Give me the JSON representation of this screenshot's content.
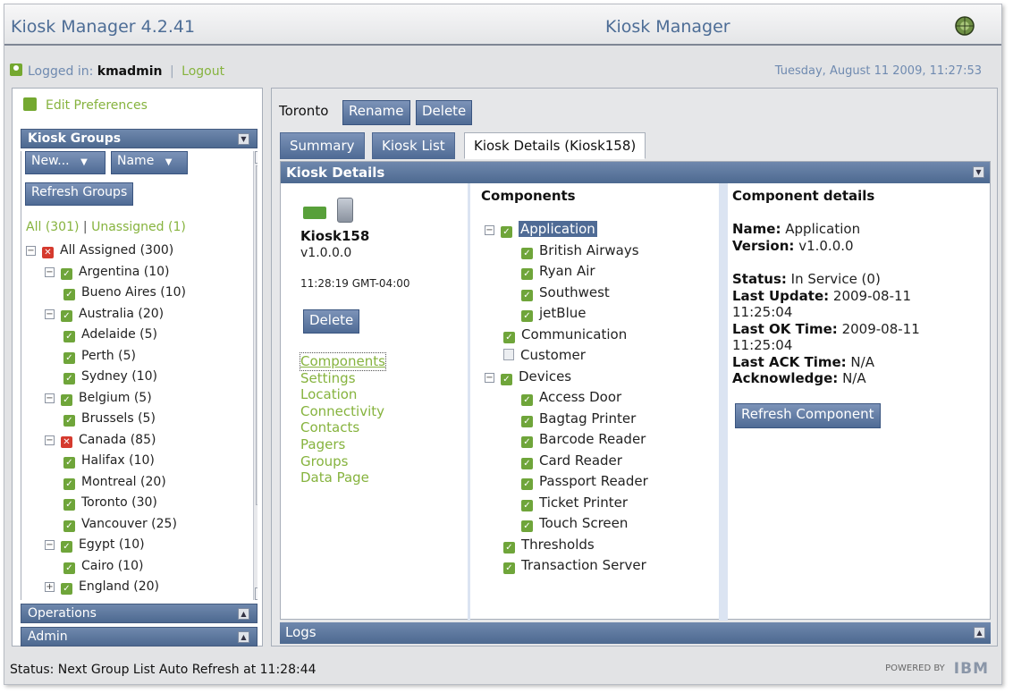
{
  "header": {
    "app_title": "Kiosk Manager 4.2.41",
    "center_title": "Kiosk Manager",
    "globe_icon": "globe-icon"
  },
  "login": {
    "label": "Logged in:",
    "user": "kmadmin",
    "separator": "|",
    "logout": "Logout",
    "datetime": "Tuesday, August 11 2009, 11:27:53"
  },
  "sidebar": {
    "edit_preferences": "Edit Preferences",
    "groups_title": "Kiosk Groups",
    "new_dropdown": "New...",
    "name_dropdown": "Name",
    "refresh_groups": "Refresh Groups",
    "counts": {
      "all": "All",
      "all_count": "(301)",
      "separator": "|",
      "unassigned": "Unassigned",
      "unassigned_count": "(1)"
    },
    "tree": [
      {
        "label": "All Assigned (300)",
        "level": 0,
        "expander": "−",
        "status": "error"
      },
      {
        "label": "Argentina (10)",
        "level": 1,
        "expander": "−",
        "status": "ok"
      },
      {
        "label": "Bueno Aires (10)",
        "level": 2,
        "expander": "",
        "status": "ok"
      },
      {
        "label": "Australia (20)",
        "level": 1,
        "expander": "−",
        "status": "ok"
      },
      {
        "label": "Adelaide (5)",
        "level": 2,
        "expander": "",
        "status": "ok"
      },
      {
        "label": "Perth (5)",
        "level": 2,
        "expander": "",
        "status": "ok"
      },
      {
        "label": "Sydney (10)",
        "level": 2,
        "expander": "",
        "status": "ok"
      },
      {
        "label": "Belgium (5)",
        "level": 1,
        "expander": "−",
        "status": "ok"
      },
      {
        "label": "Brussels (5)",
        "level": 2,
        "expander": "",
        "status": "ok"
      },
      {
        "label": "Canada (85)",
        "level": 1,
        "expander": "−",
        "status": "error"
      },
      {
        "label": "Halifax (10)",
        "level": 2,
        "expander": "",
        "status": "ok"
      },
      {
        "label": "Montreal (20)",
        "level": 2,
        "expander": "",
        "status": "ok"
      },
      {
        "label": "Toronto (30)",
        "level": 2,
        "expander": "",
        "status": "ok"
      },
      {
        "label": "Vancouver (25)",
        "level": 2,
        "expander": "",
        "status": "ok"
      },
      {
        "label": "Egypt (10)",
        "level": 1,
        "expander": "−",
        "status": "ok"
      },
      {
        "label": "Cairo (10)",
        "level": 2,
        "expander": "",
        "status": "ok"
      },
      {
        "label": "England (20)",
        "level": 1,
        "expander": "+",
        "status": "ok"
      }
    ],
    "operations": "Operations",
    "admin": "Admin"
  },
  "main": {
    "location_title": "Toronto",
    "rename_button": "Rename",
    "delete_button": "Delete",
    "tabs": [
      {
        "label": "Summary",
        "active": false
      },
      {
        "label": "Kiosk List",
        "active": false
      },
      {
        "label": "Kiosk Details (Kiosk158)",
        "active": true
      }
    ],
    "details_title": "Kiosk Details",
    "kiosk": {
      "name": "Kiosk158",
      "version": "v1.0.0.0",
      "time": "11:28:19 GMT-04:00",
      "delete_button": "Delete",
      "links": [
        "Components",
        "Settings",
        "Location",
        "Connectivity",
        "Contacts",
        "Pagers",
        "Groups",
        "Data Page"
      ]
    },
    "components": {
      "title": "Components",
      "tree": [
        {
          "label": "Application",
          "level": 0,
          "expander": "−",
          "status": "ok",
          "selected": true
        },
        {
          "label": "British Airways",
          "level": 1,
          "expander": "",
          "status": "ok"
        },
        {
          "label": "Ryan Air",
          "level": 1,
          "expander": "",
          "status": "ok"
        },
        {
          "label": "Southwest",
          "level": 1,
          "expander": "",
          "status": "ok"
        },
        {
          "label": "jetBlue",
          "level": 1,
          "expander": "",
          "status": "ok"
        },
        {
          "label": "Communication",
          "level": 0,
          "expander": "",
          "status": "ok"
        },
        {
          "label": "Customer",
          "level": 0,
          "expander": "",
          "status": "person"
        },
        {
          "label": "Devices",
          "level": 0,
          "expander": "−",
          "status": "ok"
        },
        {
          "label": "Access Door",
          "level": 1,
          "expander": "",
          "status": "ok"
        },
        {
          "label": "Bagtag Printer",
          "level": 1,
          "expander": "",
          "status": "ok"
        },
        {
          "label": "Barcode Reader",
          "level": 1,
          "expander": "",
          "status": "ok"
        },
        {
          "label": "Card Reader",
          "level": 1,
          "expander": "",
          "status": "ok"
        },
        {
          "label": "Passport Reader",
          "level": 1,
          "expander": "",
          "status": "ok"
        },
        {
          "label": "Ticket Printer",
          "level": 1,
          "expander": "",
          "status": "ok"
        },
        {
          "label": "Touch Screen",
          "level": 1,
          "expander": "",
          "status": "ok"
        },
        {
          "label": "Thresholds",
          "level": 0,
          "expander": "",
          "status": "ok"
        },
        {
          "label": "Transaction Server",
          "level": 0,
          "expander": "",
          "status": "ok"
        }
      ]
    },
    "component_details": {
      "title": "Component details",
      "name_label": "Name:",
      "name_value": "Application",
      "version_label": "Version:",
      "version_value": "v1.0.0.0",
      "status_label": "Status:",
      "status_value": "In Service (0)",
      "last_update_label": "Last Update:",
      "last_update_date": "2009-08-11",
      "last_update_time": "11:25:04",
      "last_ok_label": "Last OK Time:",
      "last_ok_date": "2009-08-11",
      "last_ok_time": "11:25:04",
      "last_ack_label": "Last ACK Time:",
      "last_ack_value": "N/A",
      "acknowledge_label": "Acknowledge:",
      "acknowledge_value": "N/A",
      "refresh_button": "Refresh Component"
    },
    "logs_title": "Logs"
  },
  "footer": {
    "status": "Status: Next Group List Auto Refresh at 11:28:44",
    "powered_by": "POWERED BY",
    "brand": "IBM"
  },
  "colors": {
    "accent_blue": "#4f6b95",
    "link_green": "#86b33e",
    "ok_green": "#6fa53a",
    "error_red": "#d53a2e"
  }
}
